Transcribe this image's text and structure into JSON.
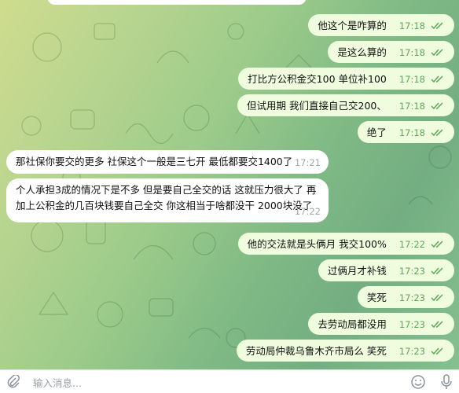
{
  "messages": [
    {
      "dir": "out",
      "text": "他这个是咋算的",
      "time": "17:18"
    },
    {
      "dir": "out",
      "text": "是这么算的",
      "time": "17:18"
    },
    {
      "dir": "out",
      "text": "打比方公积金交100 单位补100",
      "time": "17:18"
    },
    {
      "dir": "out",
      "text": "但试用期 我们直接自己交200、",
      "time": "17:18"
    },
    {
      "dir": "out",
      "text": "绝了",
      "time": "17:18"
    },
    {
      "dir": "in",
      "text": "那社保你要交的更多  社保这个一般是三七开  最低都要交1400了",
      "time": "17:21"
    },
    {
      "dir": "in",
      "text": "个人承担3成的情况下是不多 但是要自己全交的话 这就压力很大了  再加上公积金的几百块钱要自己全交  你这相当于啥都没干 2000块没了",
      "time": "17:22"
    },
    {
      "dir": "out",
      "text": "他的交法就是头俩月 我交100%",
      "time": "17:22"
    },
    {
      "dir": "out",
      "text": "过俩月才补钱",
      "time": "17:23"
    },
    {
      "dir": "out",
      "text": "笑死",
      "time": "17:23"
    },
    {
      "dir": "out",
      "text": "去劳动局都没用",
      "time": "17:23"
    },
    {
      "dir": "out",
      "text": "劳动局仲裁乌鲁木齐市局么 笑死",
      "time": "17:23"
    }
  ],
  "composer": {
    "placeholder": "输入消息..."
  },
  "colors": {
    "outgoing_bubble": "#effdde",
    "incoming_bubble": "#ffffff",
    "read_check": "#5fa55b"
  },
  "icons": [
    "paperclip-icon",
    "emoji-icon",
    "microphone-icon",
    "double-check-icon"
  ]
}
